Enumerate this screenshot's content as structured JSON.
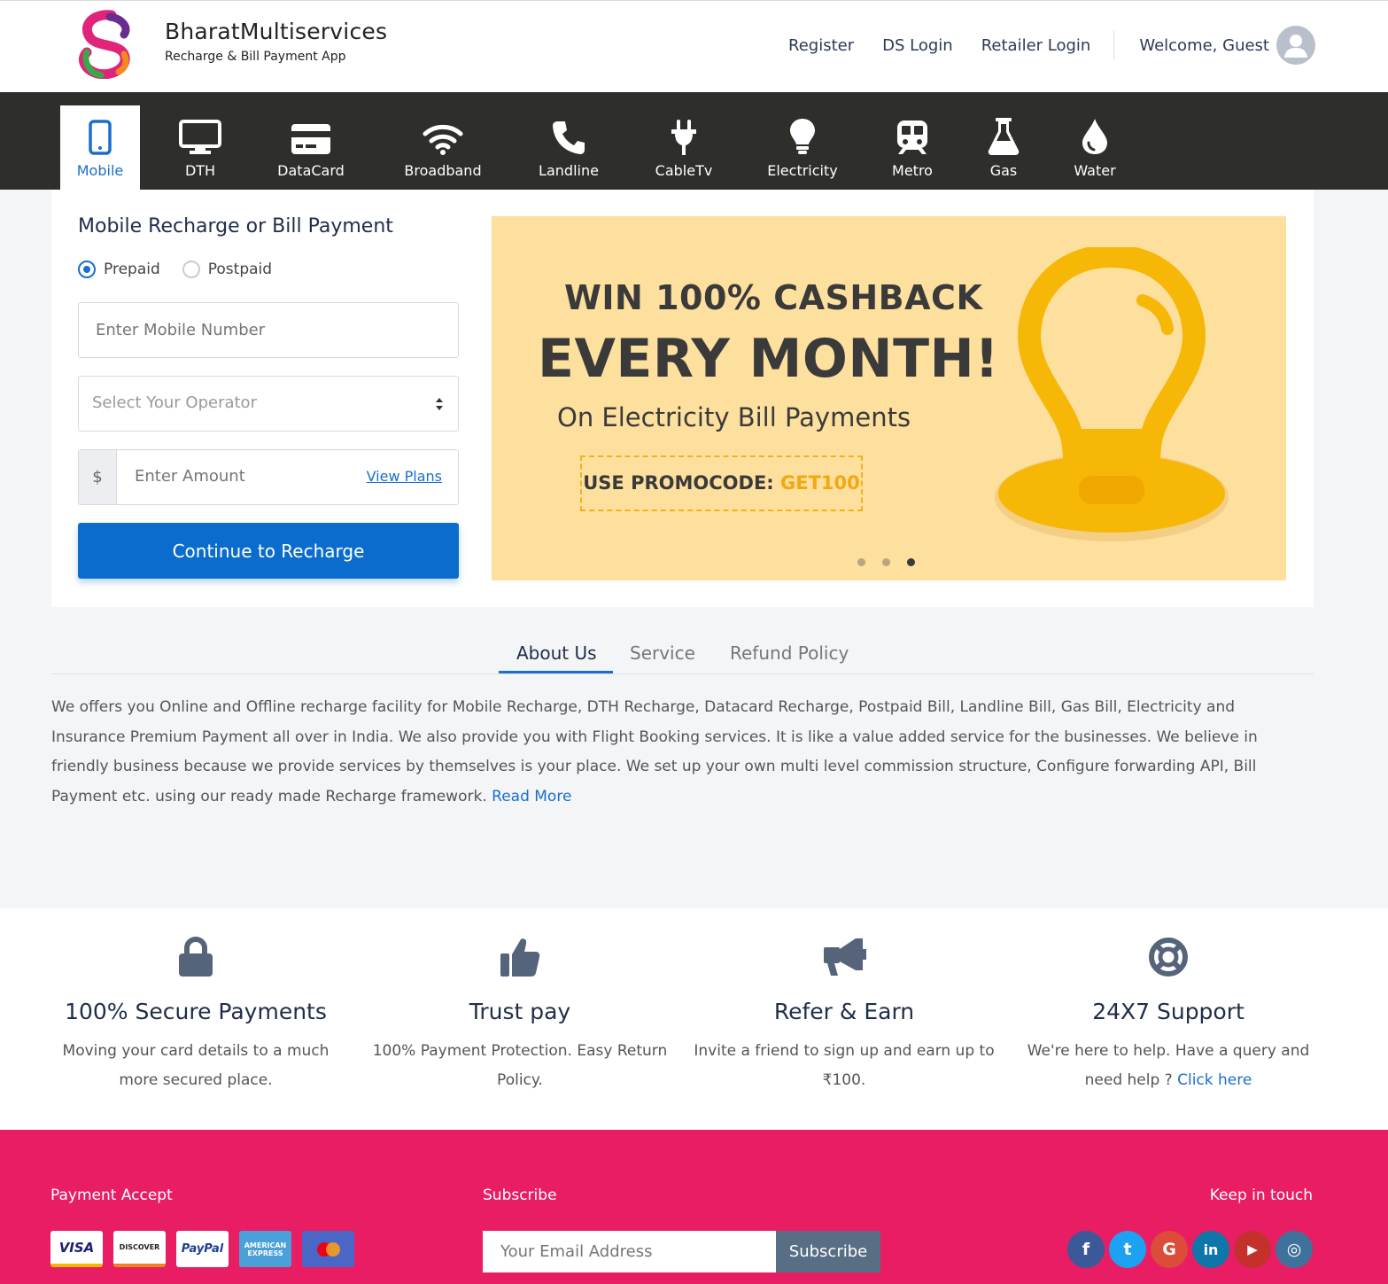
{
  "header": {
    "brand_name": "BharatMultiservices",
    "brand_tagline": "Recharge & Bill Payment App",
    "nav": [
      "Register",
      "DS Login",
      "Retailer Login"
    ],
    "welcome": "Welcome, Guest"
  },
  "services": [
    {
      "label": "Mobile",
      "icon": "mobile-icon",
      "active": true
    },
    {
      "label": "DTH",
      "icon": "monitor-icon"
    },
    {
      "label": "DataCard",
      "icon": "credit-card-icon"
    },
    {
      "label": "Broadband",
      "icon": "wifi-icon"
    },
    {
      "label": "Landline",
      "icon": "phone-icon"
    },
    {
      "label": "CableTv",
      "icon": "plug-icon"
    },
    {
      "label": "Electricity",
      "icon": "lightbulb-icon"
    },
    {
      "label": "Metro",
      "icon": "train-icon"
    },
    {
      "label": "Gas",
      "icon": "flask-icon"
    },
    {
      "label": "Water",
      "icon": "droplet-icon"
    }
  ],
  "form": {
    "title": "Mobile Recharge or Bill Payment",
    "radio_prepaid": "Prepaid",
    "radio_postpaid": "Postpaid",
    "selected_plan": "Prepaid",
    "mobile_placeholder": "Enter Mobile Number",
    "operator_placeholder": "Select Your Operator",
    "currency_symbol": "$",
    "amount_placeholder": "Enter Amount",
    "view_plans": "View Plans",
    "submit": "Continue to Recharge"
  },
  "banner": {
    "line1": "WIN 100% CASHBACK",
    "line2": "EVERY MONTH!",
    "line3": "On Electricity Bill Payments",
    "promo_label": "USE PROMOCODE: ",
    "promo_code": "GET100",
    "slide_count": 3,
    "active_slide": 3
  },
  "tabs": {
    "items": [
      "About Us",
      "Service",
      "Refund Policy"
    ],
    "active": "About Us"
  },
  "about": {
    "text": "We offers you Online and Offline recharge facility for Mobile Recharge, DTH Recharge, Datacard Recharge, Postpaid Bill, Landline Bill, Gas Bill, Electricity and Insurance Premium Payment all over in India. We also provide you with Flight Booking services. It is like a value added service for the businesses. We believe in friendly business because we provide services by themselves is your place. We set up your own multi level commission structure, Configure forwarding API, Bill Payment etc. using our ready made Recharge framework. ",
    "read_more": "Read More"
  },
  "features": [
    {
      "icon": "lock-icon",
      "title": "100% Secure Payments",
      "text": "Moving your card details to a much more secured place."
    },
    {
      "icon": "thumbs-up-icon",
      "title": "Trust pay",
      "text": "100% Payment Protection. Easy Return Policy."
    },
    {
      "icon": "megaphone-icon",
      "title": "Refer & Earn",
      "text": "Invite a friend to sign up and earn up to ₹100."
    },
    {
      "icon": "life-ring-icon",
      "title": "24X7 Support",
      "text": "We're here to help. Have a query and need help ? ",
      "link": "Click here"
    }
  ],
  "footer": {
    "payment_title": "Payment Accept",
    "payment_cards": [
      "VISA",
      "DISCOVER",
      "PayPal",
      "AMERICAN EXPRESS",
      "mastercard-icon"
    ],
    "subscribe_title": "Subscribe",
    "email_placeholder": "Your Email Address",
    "subscribe_button": "Subscribe",
    "social_title": "Keep in touch",
    "socials": [
      {
        "name": "facebook-icon",
        "glyph": "f",
        "color": "#3b5998"
      },
      {
        "name": "twitter-icon",
        "glyph": "t",
        "color": "#1da1f2"
      },
      {
        "name": "google-icon",
        "glyph": "G",
        "color": "#dd4b39"
      },
      {
        "name": "linkedin-icon",
        "glyph": "in",
        "color": "#0e76a8"
      },
      {
        "name": "youtube-icon",
        "glyph": "▶",
        "color": "#c4302b"
      },
      {
        "name": "instagram-icon",
        "glyph": "◎",
        "color": "#3f729b"
      }
    ]
  },
  "colors": {
    "primary": "#0a6ccd",
    "service_bar": "#2e2e2b",
    "footer": "#e91d63",
    "banner_bg": "#fddf9e",
    "banner_accent": "#f2b21b"
  }
}
